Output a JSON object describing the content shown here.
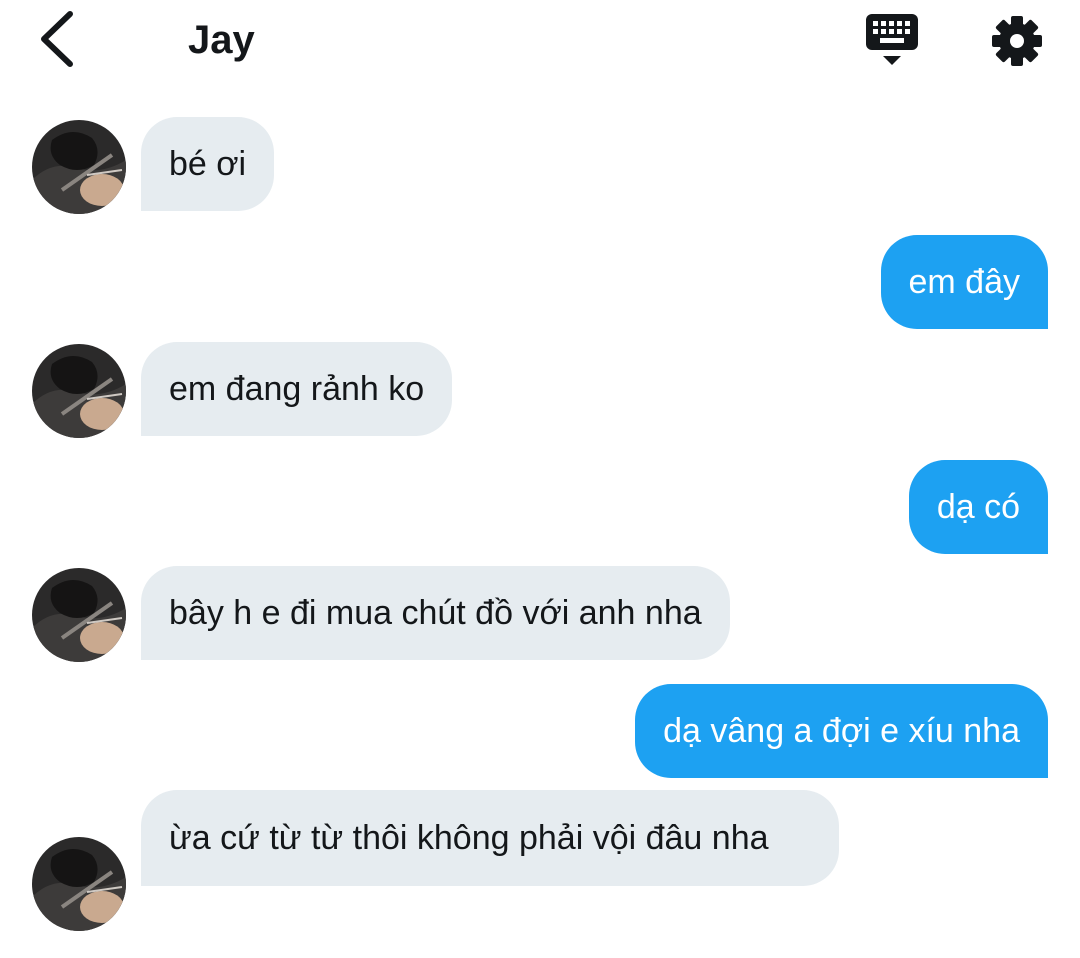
{
  "header": {
    "title": "Jay",
    "back_icon": "chevron-left-icon",
    "keyboard_icon": "keyboard-dismiss-icon",
    "settings_icon": "gear-icon"
  },
  "colors": {
    "incoming_bubble": "#e6ecf0",
    "outgoing_bubble": "#1da1f2",
    "text_dark": "#14171a"
  },
  "messages": [
    {
      "from": "Jay",
      "text": "bé ơi"
    },
    {
      "from": "me",
      "text": "em đây"
    },
    {
      "from": "Jay",
      "text": "em đang rảnh ko"
    },
    {
      "from": "me",
      "text": "dạ có"
    },
    {
      "from": "Jay",
      "text": "bây h e đi mua chút đồ với anh nha"
    },
    {
      "from": "me",
      "text": "dạ vâng a đợi e xíu nha"
    },
    {
      "from": "Jay",
      "text": "ừa cứ từ từ thôi không phải vội đâu nha"
    }
  ]
}
